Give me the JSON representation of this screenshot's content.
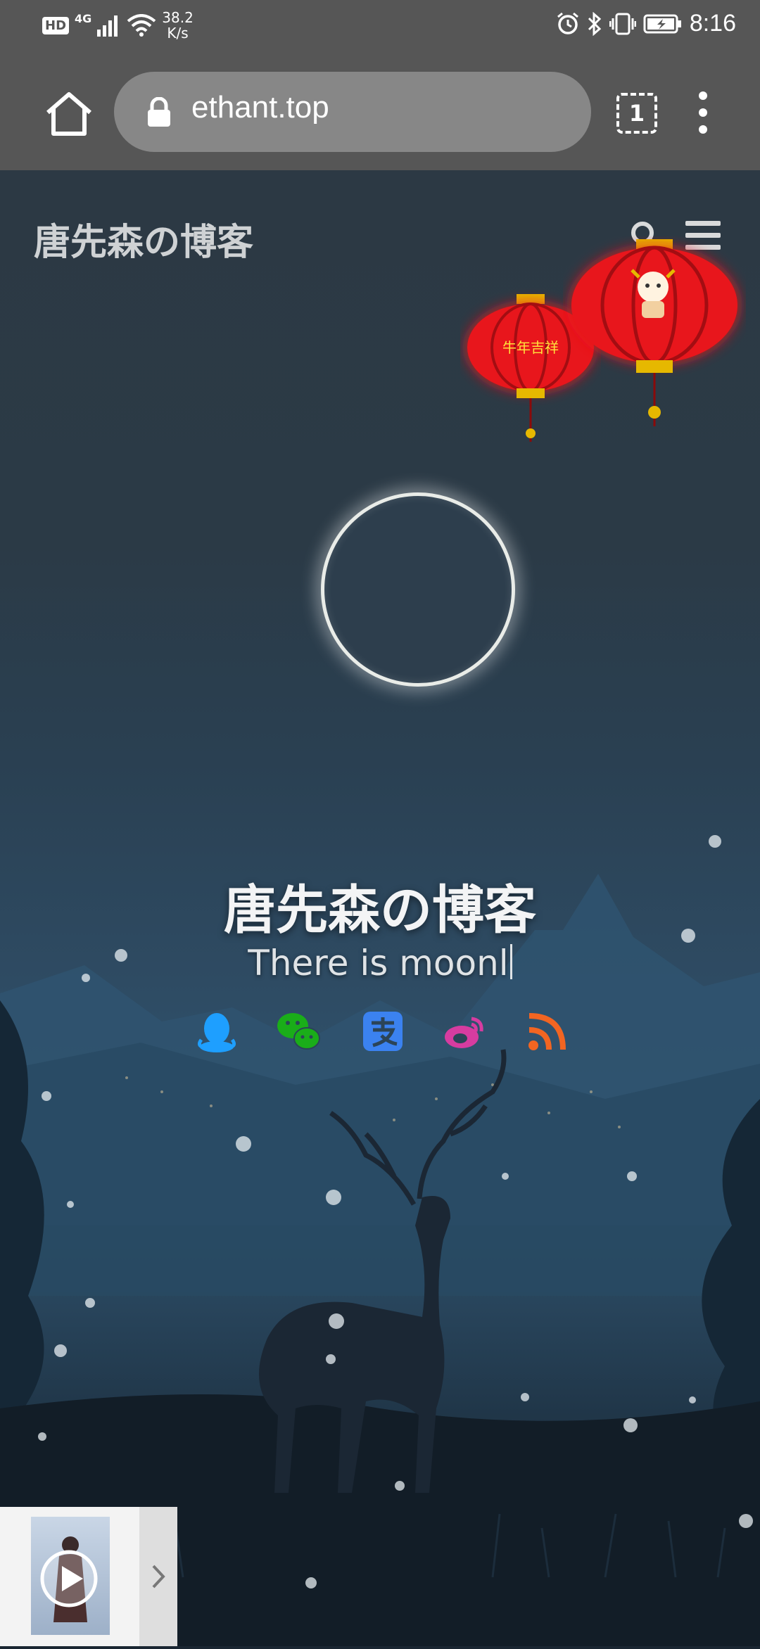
{
  "status_bar": {
    "hd_badge": "HD",
    "network_type": "4G",
    "speed_value": "38.2",
    "speed_unit": "K/s",
    "time": "8:16"
  },
  "browser": {
    "url": "ethant.top",
    "tab_count": "1"
  },
  "site": {
    "header_title": "唐先森の博客",
    "hero_title": "唐先森の博客",
    "hero_subtitle": "There is moonl",
    "lantern_text": "牛年吉祥",
    "social_icons": [
      "qq-icon",
      "wechat-icon",
      "alipay-icon",
      "weibo-icon",
      "rss-icon"
    ]
  },
  "colors": {
    "browser_chrome": "#565656",
    "url_pill": "#878787",
    "lantern_red": "#e8151c",
    "qq": "#1e9fff",
    "wechat": "#1aad19",
    "alipay": "#3b82f0",
    "weibo": "#e6162d",
    "rss": "#f26522"
  }
}
